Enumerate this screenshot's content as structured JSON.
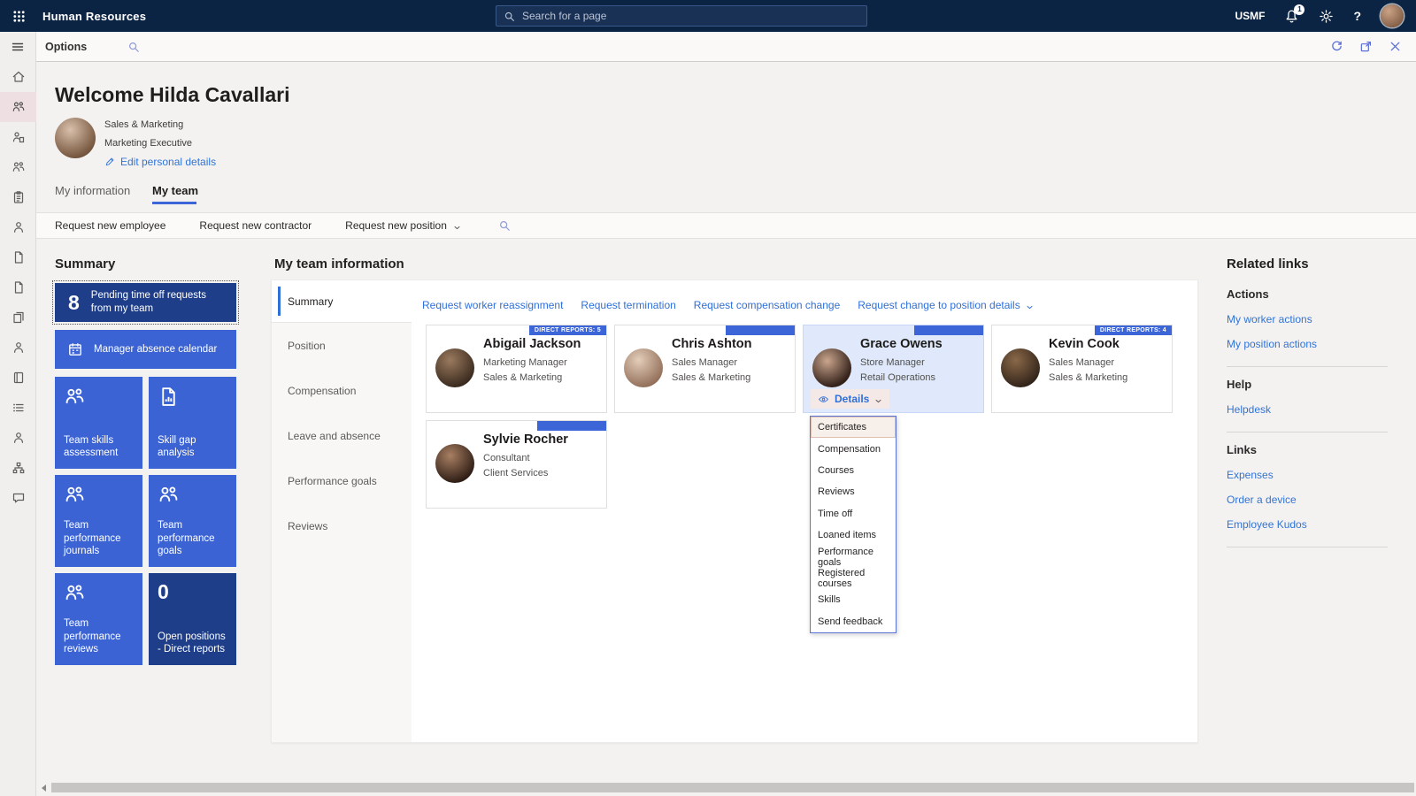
{
  "topbar": {
    "app_title": "Human Resources",
    "search_placeholder": "Search for a page",
    "company": "USMF",
    "notification_count": "1"
  },
  "toolbar": {
    "options_label": "Options"
  },
  "sidebar": {
    "items": [
      {
        "name": "home-icon",
        "icon": "home"
      },
      {
        "name": "my-team-icon",
        "icon": "people",
        "class": "selected"
      },
      {
        "name": "employee-management-icon",
        "icon": "person-doc"
      },
      {
        "name": "personnel-icon",
        "icon": "people"
      },
      {
        "name": "tasks-icon",
        "icon": "clipboard"
      },
      {
        "name": "worker-icon",
        "icon": "person"
      },
      {
        "name": "requests-icon",
        "icon": "doc"
      },
      {
        "name": "approvals-icon",
        "icon": "doc"
      },
      {
        "name": "documents-icon",
        "icon": "docs"
      },
      {
        "name": "benefits-icon",
        "icon": "person"
      },
      {
        "name": "records-icon",
        "icon": "book"
      },
      {
        "name": "list-icon",
        "icon": "list"
      },
      {
        "name": "workspace-icon",
        "icon": "person"
      },
      {
        "name": "organization-icon",
        "icon": "org"
      },
      {
        "name": "feedback-icon",
        "icon": "chat"
      }
    ]
  },
  "welcome": {
    "title": "Welcome Hilda Cavallari",
    "department": "Sales & Marketing",
    "job_title": "Marketing Executive",
    "edit_link": "Edit personal details"
  },
  "page_tabs": {
    "info": "My information",
    "team": "My team"
  },
  "action_bar": {
    "items": [
      "Request new employee",
      "Request new contractor"
    ],
    "dropdown_item": "Request new position"
  },
  "summary": {
    "heading": "Summary",
    "wide_tiles": [
      {
        "number": "8",
        "label": "Pending time off requests from my team",
        "class": "dark focused"
      },
      {
        "icon": "calendar",
        "label": "Manager absence calendar"
      }
    ],
    "tiles": [
      {
        "icon": "people",
        "label": "Team skills assessment"
      },
      {
        "icon": "chart-doc",
        "label": "Skill gap analysis"
      },
      {
        "icon": "people",
        "label": "Team performance journals"
      },
      {
        "icon": "people",
        "label": "Team performance goals"
      },
      {
        "icon": "people",
        "label": "Team performance reviews"
      },
      {
        "number": "0",
        "label": "Open positions - Direct reports",
        "class": "dark"
      }
    ]
  },
  "team_panel": {
    "heading": "My team information",
    "side_tabs": [
      {
        "label": "Summary",
        "class": "selected"
      },
      {
        "label": "Position"
      },
      {
        "label": "Compensation"
      },
      {
        "label": "Leave and absence"
      },
      {
        "label": "Performance goals"
      },
      {
        "label": "Reviews"
      }
    ],
    "links": [
      "Request worker reassignment",
      "Request termination",
      "Request compensation change"
    ],
    "links_dropdown": "Request change to position details",
    "cards": [
      {
        "name": "Abigail Jackson",
        "role": "Marketing Manager",
        "dept": "Sales & Marketing",
        "ribbon": "Direct reports: 5",
        "class": "av1"
      },
      {
        "name": "Chris Ashton",
        "role": "Sales Manager",
        "dept": "Sales & Marketing",
        "ribbon": "",
        "class": "av2"
      },
      {
        "name": "Grace Owens",
        "role": "Store Manager",
        "dept": "Retail Operations",
        "ribbon": "",
        "class": "av3 selected has-details"
      },
      {
        "name": "Kevin Cook",
        "role": "Sales Manager",
        "dept": "Sales & Marketing",
        "ribbon": "Direct reports: 4",
        "class": "av4"
      },
      {
        "name": "Sylvie Rocher",
        "role": "Consultant",
        "dept": "Client Services",
        "ribbon": "",
        "class": "av5"
      }
    ],
    "details_button": "Details",
    "menu": {
      "items": [
        {
          "label": "Certificates",
          "class": "highlighted"
        },
        {
          "label": "Compensation"
        },
        {
          "label": "Courses"
        },
        {
          "label": "Reviews"
        },
        {
          "label": "Time off"
        },
        {
          "label": "Loaned items"
        },
        {
          "label": "Performance goals"
        },
        {
          "label": "Registered courses"
        },
        {
          "label": "Skills"
        },
        {
          "label": "Send feedback"
        }
      ]
    }
  },
  "related_links": {
    "heading": "Related links",
    "sections": [
      {
        "title": "Actions",
        "links": [
          "My worker actions",
          "My position actions"
        ]
      },
      {
        "title": "Help",
        "links": [
          "Helpdesk"
        ]
      },
      {
        "title": "Links",
        "links": [
          "Expenses",
          "Order a device",
          "Employee Kudos"
        ]
      }
    ]
  }
}
